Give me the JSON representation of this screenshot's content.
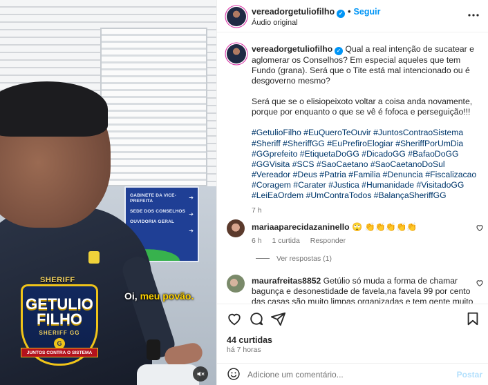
{
  "video": {
    "subtitle_prefix": "Oi, ",
    "subtitle_highlight": "meu povão.",
    "sign_lines": [
      "GABINETE DA VICE-PREFEITA",
      "SEDE DOS CONSELHOS",
      "OUVIDORIA GERAL"
    ],
    "badge": {
      "top": "SHERIFF",
      "name1": "GETULIO",
      "name2": "FILHO",
      "sub": "SHERIFF GG",
      "star": "G",
      "ribbon": "JUNTOS CONTRA O SISTEMA"
    },
    "muted": true
  },
  "header": {
    "username": "vereadorgetuliofilho",
    "follow_label": "Seguir",
    "separator": "•",
    "audio_label": "Áudio original"
  },
  "caption": {
    "username": "vereadorgetuliofilho",
    "paragraph1": "Qual a real intenção de sucatear e aglomerar os Conselhos? Em especial aqueles que tem Fundo (grana). Será que o Tite está mal intencionado ou é desgoverno mesmo?",
    "paragraph2": "Será que se o elisiopeixoto voltar a coisa anda novamente, porque por enquanto o que se vê é fofoca e perseguição!!!",
    "hashtags": "#GetulioFilho #EuQueroTeOuvir #JuntosContraoSistema #Sheriff #SheriffGG #EuPrefiroElogiar #SheriffPorUmDia #GGprefeito #EtiquetaDoGG #DicadoGG #BafaoDoGG #GGVisita #SCS #SaoCaetano #SaoCaetanoDoSul #Vereador #Deus #Patria #Familia #Denuncia #Fiscalizacao #Coragem #Carater #Justica #Humanidade #VisitadoGG #LeiEaOrdem #UmContraTodos #BalançaSheriffGG",
    "time": "7 h"
  },
  "comments": [
    {
      "username": "mariaaparecidazaninello",
      "text": "🙄 👏👏👏👏👏",
      "time": "6 h",
      "replies_count": "1 curtida",
      "reply_label": "Responder",
      "view_replies": "Ver respostas (1)"
    },
    {
      "username": "maurafreitas8852",
      "text": "Getúlio só muda a forma de chamar bagunça e desonestidade de favela,na favela 99 por cento das casas são muito limpas organizadas e tem gente muito honesta!!!"
    }
  ],
  "actions": {
    "likes": "44 curtidas",
    "time_ago": "há 7 horas"
  },
  "composer": {
    "placeholder": "Adicione um comentário...",
    "post_label": "Postar"
  },
  "colors": {
    "accent": "#0095f6",
    "hashtag": "#00376b",
    "muted_text": "#737373"
  }
}
